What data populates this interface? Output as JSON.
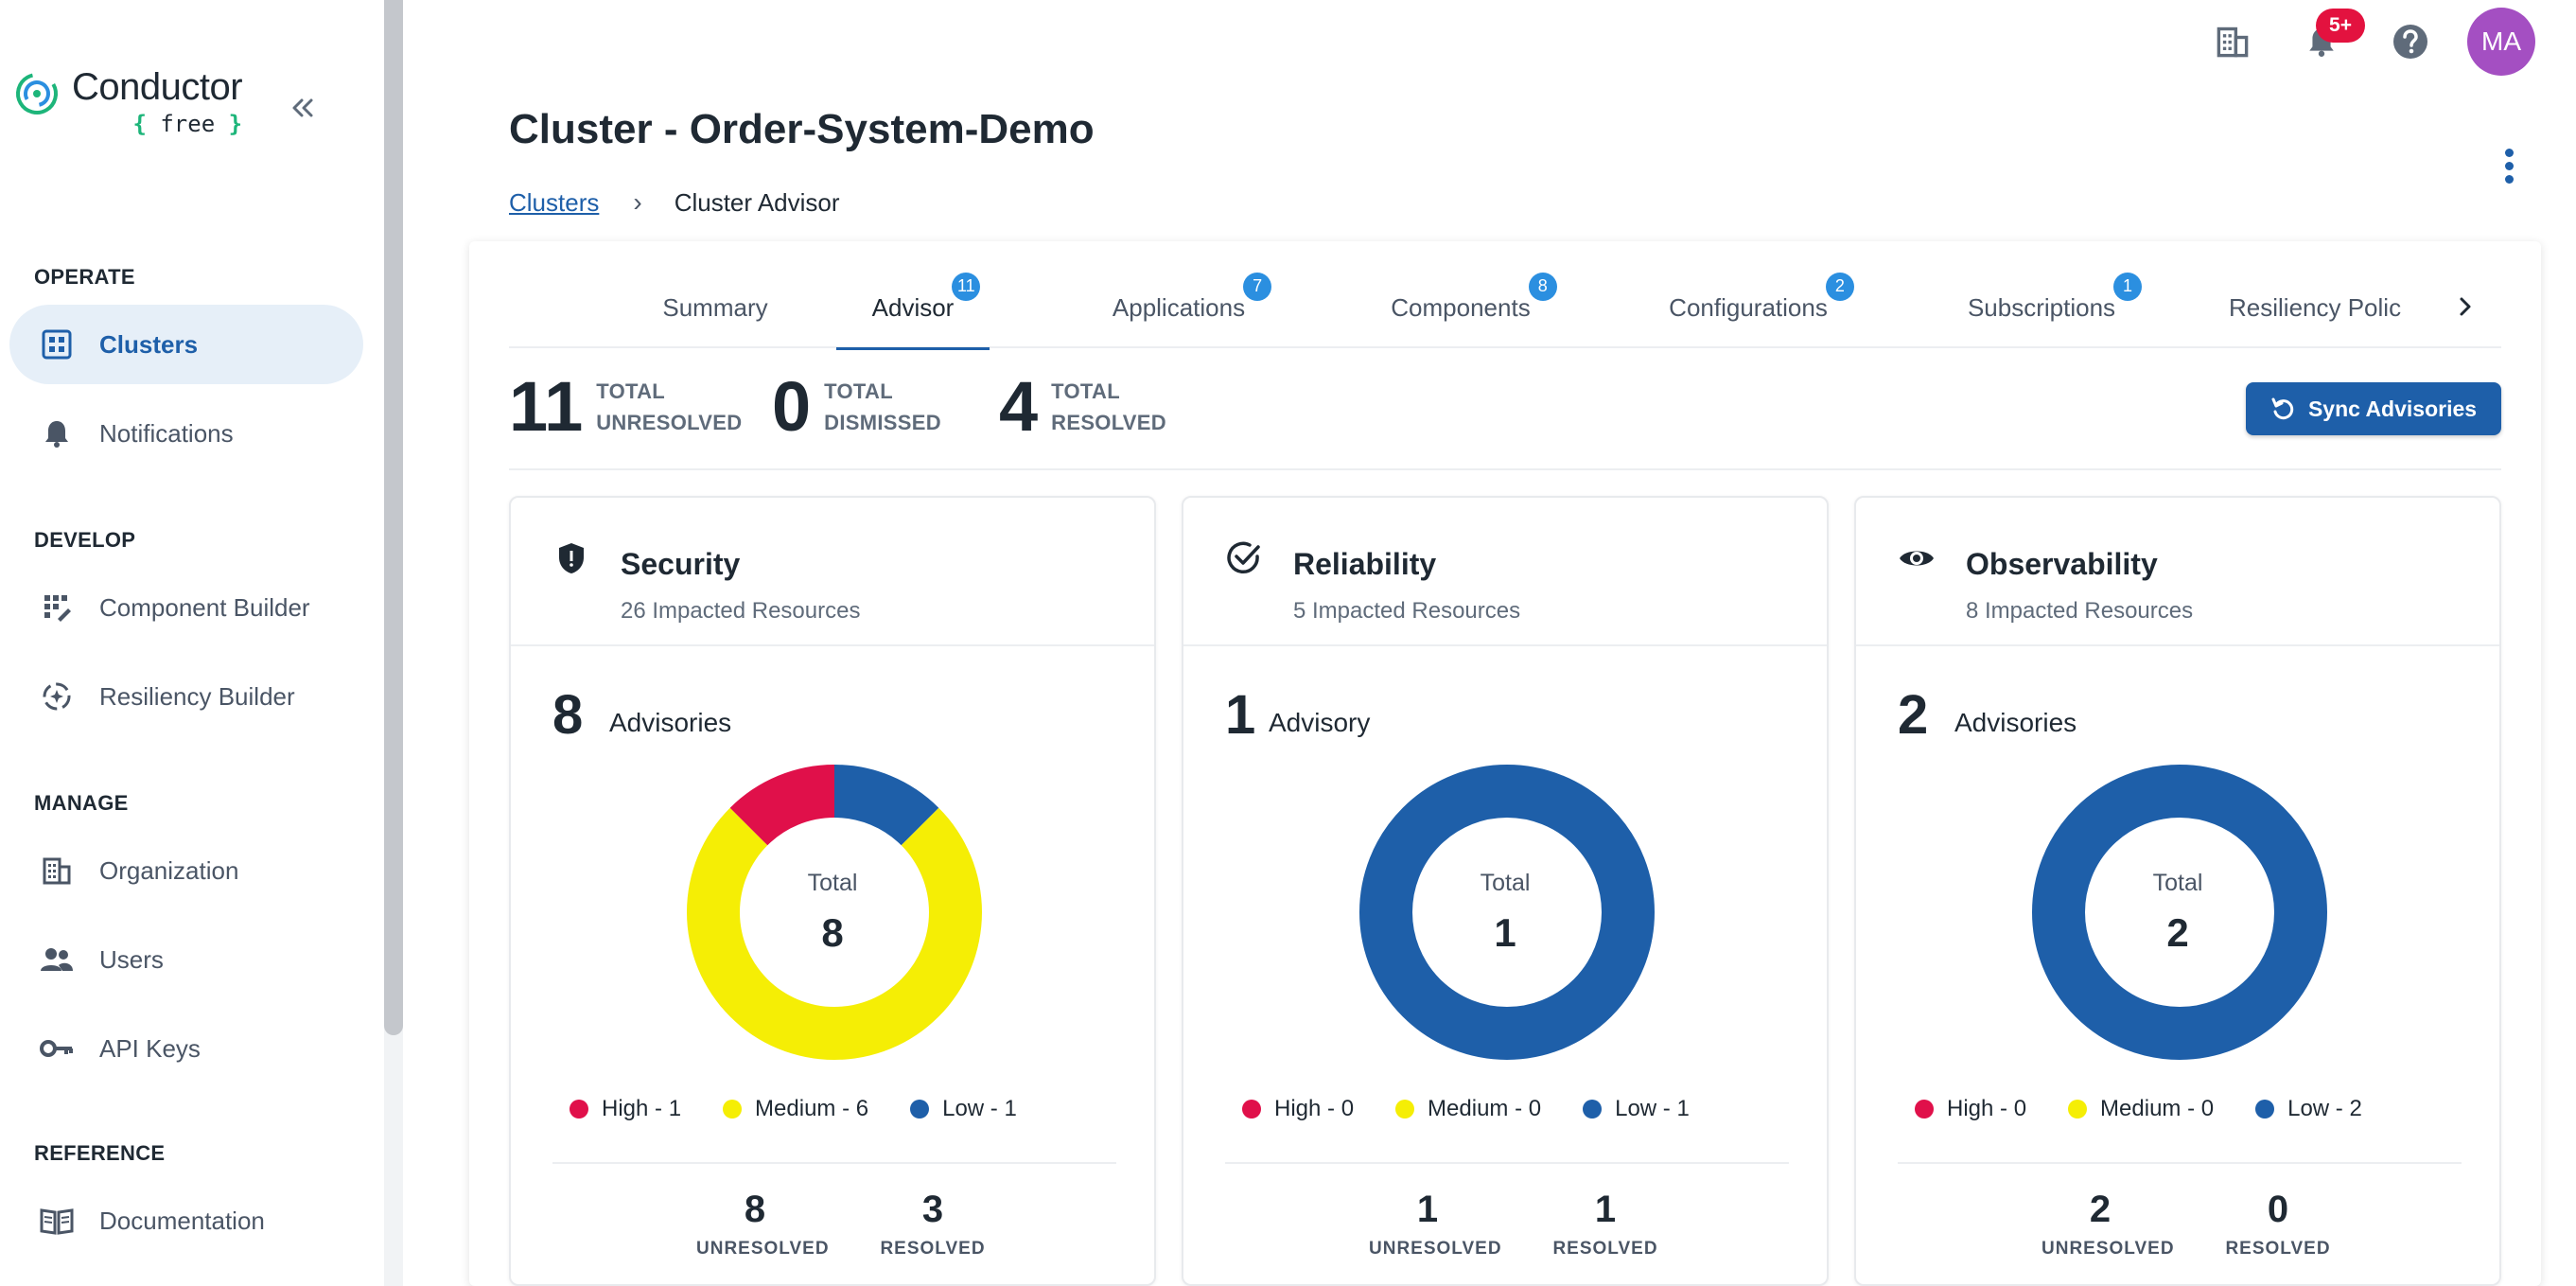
{
  "app": {
    "brand": "Conductor",
    "plan": "free"
  },
  "sidebar": {
    "sections": [
      {
        "title": "OPERATE",
        "items": [
          {
            "label": "Clusters",
            "icon": "clusters-icon",
            "active": true
          },
          {
            "label": "Notifications",
            "icon": "bell-icon"
          }
        ]
      },
      {
        "title": "DEVELOP",
        "items": [
          {
            "label": "Component Builder",
            "icon": "component-builder-icon"
          },
          {
            "label": "Resiliency Builder",
            "icon": "resiliency-builder-icon"
          }
        ]
      },
      {
        "title": "MANAGE",
        "items": [
          {
            "label": "Organization",
            "icon": "organization-icon"
          },
          {
            "label": "Users",
            "icon": "users-icon"
          },
          {
            "label": "API Keys",
            "icon": "key-icon"
          }
        ]
      },
      {
        "title": "REFERENCE",
        "items": [
          {
            "label": "Documentation",
            "icon": "book-icon"
          }
        ]
      }
    ]
  },
  "topbar": {
    "notifications_badge": "5+",
    "avatar_initials": "MA"
  },
  "page": {
    "title": "Cluster - Order-System-Demo",
    "breadcrumb": {
      "link": "Clusters",
      "current": "Cluster Advisor"
    }
  },
  "tabs": [
    {
      "label": "Summary",
      "badge": null
    },
    {
      "label": "Advisor",
      "badge": "11",
      "active": true
    },
    {
      "label": "Applications",
      "badge": "7"
    },
    {
      "label": "Components",
      "badge": "8"
    },
    {
      "label": "Configurations",
      "badge": "2"
    },
    {
      "label": "Subscriptions",
      "badge": "1"
    },
    {
      "label": "Resiliency Polic",
      "badge": null
    }
  ],
  "stats": {
    "unresolved": {
      "value": "11",
      "line1": "TOTAL",
      "line2": "UNRESOLVED"
    },
    "dismissed": {
      "value": "0",
      "line1": "TOTAL",
      "line2": "DISMISSED"
    },
    "resolved": {
      "value": "4",
      "line1": "TOTAL",
      "line2": "RESOLVED"
    }
  },
  "sync_button": "Sync Advisories",
  "colors": {
    "high": "#e0104a",
    "medium": "#f5ee05",
    "low": "#1e5fa9",
    "accent": "#1e5fa9"
  },
  "cards": [
    {
      "title": "Security",
      "icon": "shield-icon",
      "impacted": "26 Impacted Resources",
      "count": "8",
      "count_label": "Advisories",
      "total_label": "Total",
      "total": "8",
      "severity": {
        "high": 1,
        "medium": 6,
        "low": 1
      },
      "legend": [
        "High - 1",
        "Medium - 6",
        "Low - 1"
      ],
      "unresolved": "8",
      "resolved": "3",
      "unresolved_label": "UNRESOLVED",
      "resolved_label": "RESOLVED"
    },
    {
      "title": "Reliability",
      "icon": "check-circle-icon",
      "impacted": "5 Impacted Resources",
      "count": "1",
      "count_label": "Advisory",
      "total_label": "Total",
      "total": "1",
      "severity": {
        "high": 0,
        "medium": 0,
        "low": 1
      },
      "legend": [
        "High - 0",
        "Medium - 0",
        "Low - 1"
      ],
      "unresolved": "1",
      "resolved": "1",
      "unresolved_label": "UNRESOLVED",
      "resolved_label": "RESOLVED"
    },
    {
      "title": "Observability",
      "icon": "eye-icon",
      "impacted": "8 Impacted Resources",
      "count": "2",
      "count_label": "Advisories",
      "total_label": "Total",
      "total": "2",
      "severity": {
        "high": 0,
        "medium": 0,
        "low": 2
      },
      "legend": [
        "High - 0",
        "Medium - 0",
        "Low - 2"
      ],
      "unresolved": "2",
      "resolved": "0",
      "unresolved_label": "UNRESOLVED",
      "resolved_label": "RESOLVED"
    }
  ]
}
